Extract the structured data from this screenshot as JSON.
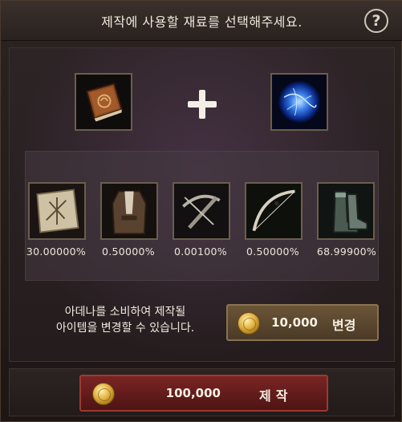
{
  "header": {
    "title": "제작에 사용할 재료를 선택해주세요.",
    "help_label": "?"
  },
  "materials": [
    {
      "icon": "book-icon"
    },
    {
      "icon": "blue-orb-icon"
    }
  ],
  "results": [
    {
      "icon": "scroll-icon",
      "chance": "30.00000%"
    },
    {
      "icon": "coat-icon",
      "chance": "0.50000%"
    },
    {
      "icon": "crossbow-icon",
      "chance": "0.00100%"
    },
    {
      "icon": "bow-icon",
      "chance": "0.50000%"
    },
    {
      "icon": "boots-icon",
      "chance": "68.99900%"
    }
  ],
  "change": {
    "description_line1": "아데나를 소비하여 제작될",
    "description_line2": "아이템을 변경할 수 있습니다.",
    "cost": "10,000",
    "label": "변경"
  },
  "craft": {
    "cost": "100,000",
    "label": "제작"
  },
  "colors": {
    "change_button": "#5a4630",
    "craft_button": "#6a1c1c",
    "coin": "#e0b040"
  }
}
